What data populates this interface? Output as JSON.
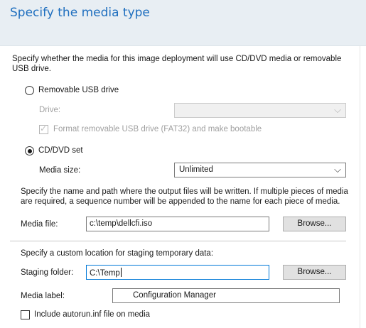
{
  "header": {
    "title": "Specify the media type"
  },
  "intro": "Specify whether the media for this image deployment will use CD/DVD media or removable USB drive.",
  "usb": {
    "label": "Removable USB drive",
    "selected": false,
    "drive_label": "Drive:",
    "drive_value": "",
    "format_label": "Format removable USB drive (FAT32) and make bootable",
    "format_checked": true
  },
  "cd": {
    "label": "CD/DVD set",
    "selected": true,
    "media_size_label": "Media size:",
    "media_size_value": "Unlimited"
  },
  "output_note": "Specify the name and path where the output files will be written.  If multiple pieces of media are required, a sequence number will be appended to the name for each piece of media.",
  "media_file": {
    "label": "Media file:",
    "value": "c:\\temp\\dellcfi.iso",
    "browse": "Browse..."
  },
  "staging_note": "Specify a custom location for staging temporary data:",
  "staging": {
    "label": "Staging folder:",
    "value": "C:\\Temp",
    "browse": "Browse..."
  },
  "media_label": {
    "label": "Media label:",
    "value": "Configuration Manager"
  },
  "autorun": {
    "label": "Include autorun.inf file on media",
    "checked": false
  },
  "icons": {
    "chevron": "chevron-down-icon",
    "check": "checkmark-icon"
  }
}
